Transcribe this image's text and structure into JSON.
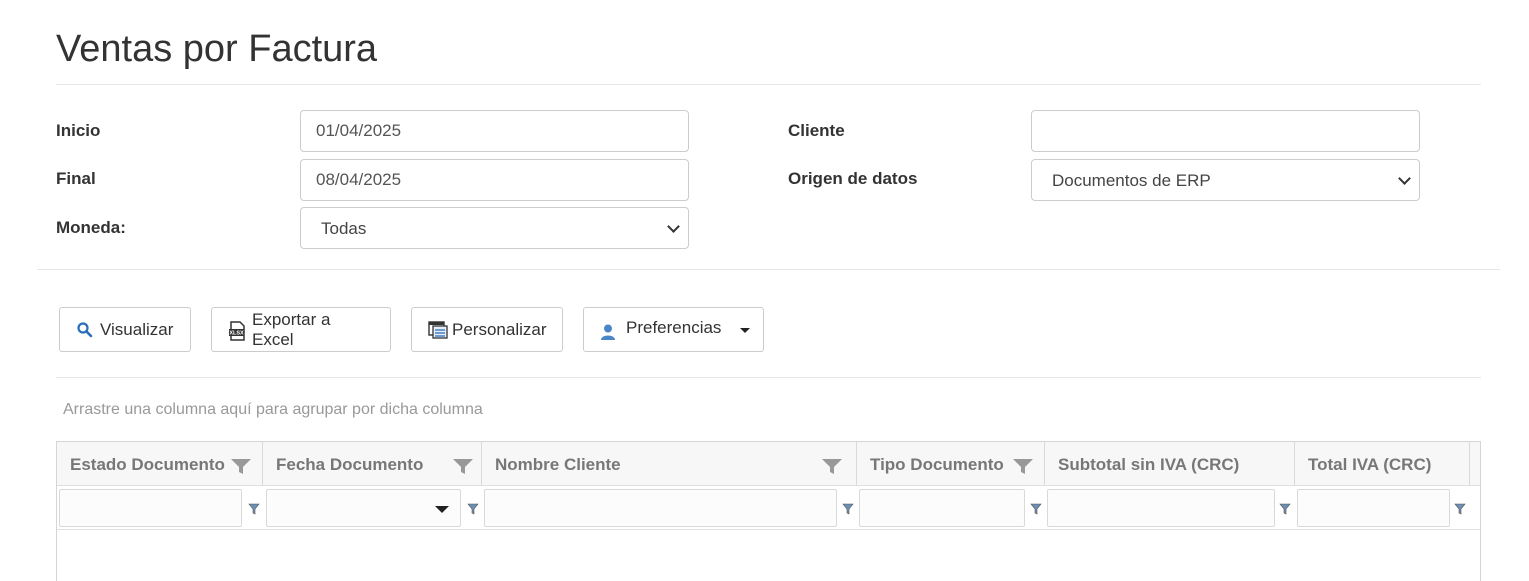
{
  "page": {
    "title": "Ventas por Factura"
  },
  "form": {
    "inicio_label": "Inicio",
    "inicio_value": "01/04/2025",
    "final_label": "Final",
    "final_value": "08/04/2025",
    "moneda_label": "Moneda:",
    "moneda_value": "Todas",
    "cliente_label": "Cliente",
    "cliente_value": "",
    "origen_label": "Origen de datos",
    "origen_value": "Documentos de ERP"
  },
  "toolbar": {
    "visualizar": "Visualizar",
    "exportar": "Exportar a Excel",
    "personalizar": "Personalizar",
    "preferencias": "Preferencias"
  },
  "grid": {
    "group_hint": "Arrastre una columna aquí para agrupar por dicha columna",
    "columns": [
      "Estado Documento",
      "Fecha Documento",
      "Nombre Cliente",
      "Tipo Documento",
      "Subtotal sin IVA (CRC)",
      "Total IVA (CRC)"
    ]
  },
  "colors": {
    "accent": "#2a6ebb",
    "border": "#cccccc",
    "header_bg": "#f7f7f7",
    "hint": "#999999"
  }
}
